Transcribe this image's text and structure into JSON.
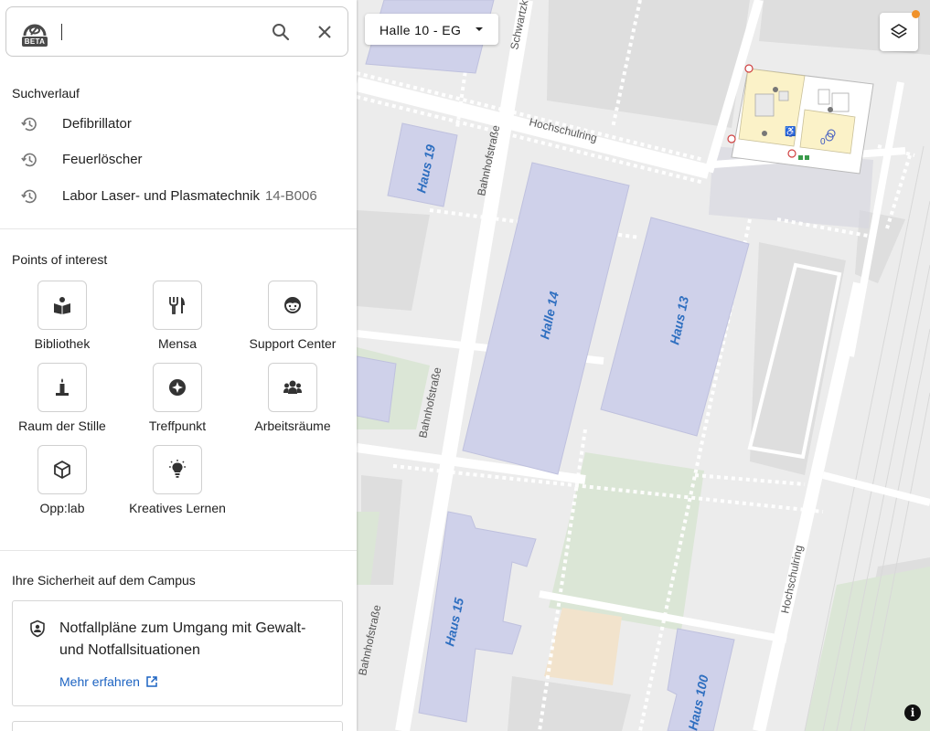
{
  "colors": {
    "accent": "#1c63c2",
    "badge_dot": "#f0922b",
    "building_fill": "#cfd1ea",
    "map_label": "#2f6fc0",
    "green_area": "#dbe6d6",
    "sand_area": "#f2e3cc"
  },
  "search": {
    "logo_badge": "BETA",
    "value": "",
    "placeholder": "",
    "search_icon": "search-icon",
    "clear_icon": "close-icon"
  },
  "history": {
    "title": "Suchverlauf",
    "icon": "history-icon",
    "items": [
      {
        "label": "Defibrillator",
        "sub": ""
      },
      {
        "label": "Feuerlöscher",
        "sub": ""
      },
      {
        "label": "Labor Laser- und Plasmatechnik",
        "sub": "14-B006"
      }
    ]
  },
  "poi": {
    "title": "Points of interest",
    "items": [
      {
        "label": "Bibliothek",
        "icon": "book-reader-icon"
      },
      {
        "label": "Mensa",
        "icon": "fork-knife-icon"
      },
      {
        "label": "Support Center",
        "icon": "support-face-icon"
      },
      {
        "label": "Raum der Stille",
        "icon": "candle-icon"
      },
      {
        "label": "Treffpunkt",
        "icon": "meeting-point-icon"
      },
      {
        "label": "Arbeitsräume",
        "icon": "group-workspace-icon"
      },
      {
        "label": "Opp:lab",
        "icon": "cube-icon"
      },
      {
        "label": "Kreatives Lernen",
        "icon": "lightbulb-icon"
      }
    ]
  },
  "safety": {
    "title": "Ihre Sicherheit auf dem Campus",
    "card_icon": "shield-person-icon",
    "card_text": "Notfallpläne zum Umgang mit Gewalt- und Notfallsituationen",
    "link_label": "Mehr erfahren",
    "link_icon": "external-link-icon"
  },
  "map": {
    "floor_selector": "Halle 10 - EG",
    "layers_icon": "layers-icon",
    "info_icon": "info-icon",
    "info_glyph": "i",
    "streets": {
      "hochschulring_top": "Hochschulring",
      "hochschulring_side": "Hochschulring",
      "bahnhofstrasse_1": "Bahnhofstraße",
      "bahnhofstrasse_2": "Bahnhofstraße",
      "bahnhofstrasse_3": "Bahnhofstraße",
      "schwartzkopff": "Schwartzk"
    },
    "buildings": {
      "haus19": "Haus 19",
      "halle14": "Halle 14",
      "haus13": "Haus 13",
      "haus15": "Haus 15",
      "haus100": "Haus 100"
    }
  }
}
